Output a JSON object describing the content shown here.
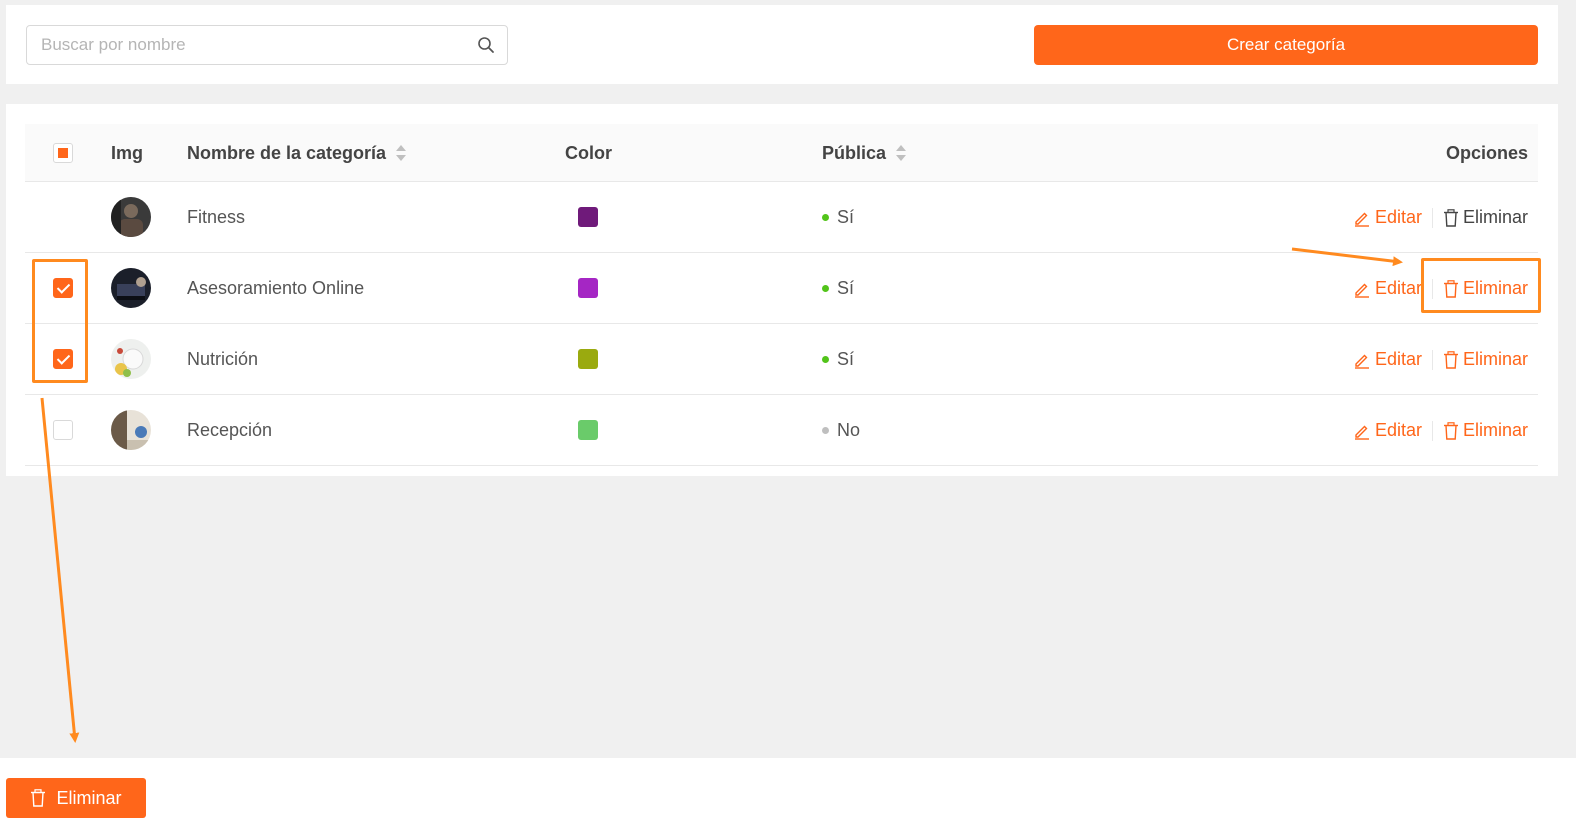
{
  "search": {
    "placeholder": "Buscar por nombre"
  },
  "toolbar": {
    "create_label": "Crear categoría"
  },
  "table": {
    "headers": {
      "img": "Img",
      "name": "Nombre de la categoría",
      "color": "Color",
      "public": "Pública",
      "options": "Opciones"
    },
    "rows": [
      {
        "name": "Fitness",
        "color": "#6f1a7a",
        "public": "Sí",
        "checked": false
      },
      {
        "name": "Asesoramiento Online",
        "color": "#a526c4",
        "public": "Sí",
        "checked": true
      },
      {
        "name": "Nutrición",
        "color": "#9aaa0f",
        "public": "Sí",
        "checked": true
      },
      {
        "name": "Recepción",
        "color": "#6acb6a",
        "public": "No",
        "checked": false
      }
    ],
    "actions": {
      "edit": "Editar",
      "delete": "Eliminar"
    }
  },
  "bulk": {
    "delete_label": "Eliminar"
  },
  "colors": {
    "accent": "#ff661a",
    "annotation": "#ff8a1f",
    "public_yes": "#52c41a",
    "public_no": "#bfbfbf"
  }
}
